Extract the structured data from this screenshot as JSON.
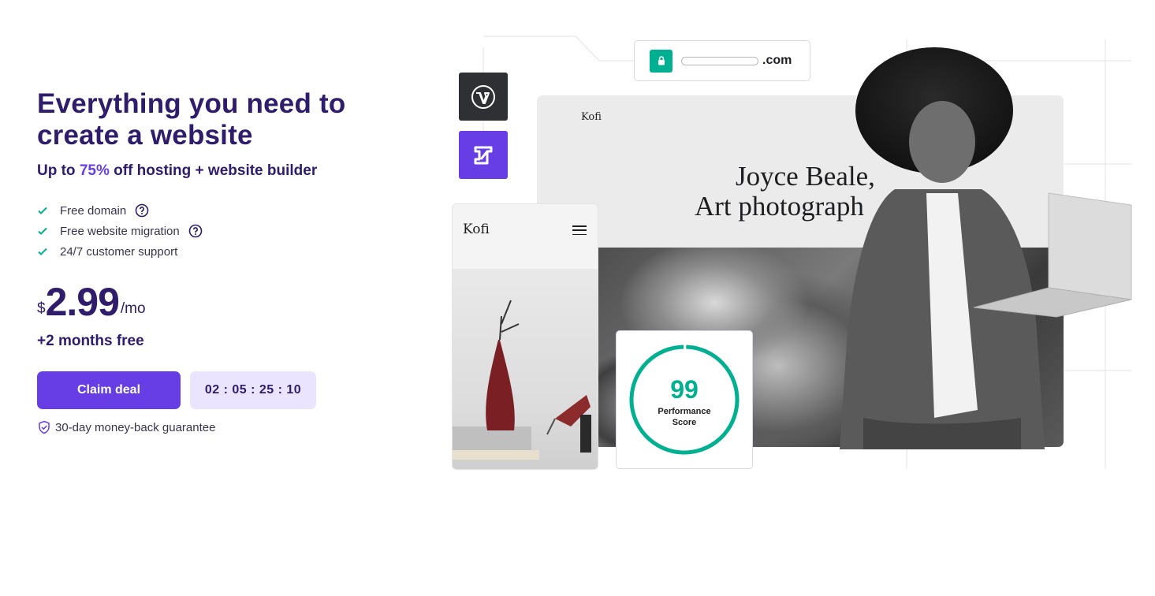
{
  "hero": {
    "headline_line1": "Everything you need to",
    "headline_line2": "create a website",
    "subhead_prefix": "Up to ",
    "subhead_accent": "75%",
    "subhead_suffix": " off hosting + website builder",
    "features": [
      {
        "label": "Free domain",
        "has_help": true
      },
      {
        "label": "Free website migration",
        "has_help": true
      },
      {
        "label": "24/7 customer support",
        "has_help": false
      }
    ],
    "price": {
      "currency": "$",
      "amount": "2.99",
      "period": "/mo"
    },
    "bonus": "+2 months free",
    "claim_label": "Claim deal",
    "timer": "02 : 05 : 25 : 10",
    "guarantee": "30-day money-back guarantee"
  },
  "illustration": {
    "url_tld": ".com",
    "desktop_brand": "Kofi",
    "desktop_title_line1": "Joyce Beale,",
    "desktop_title_line2": "Art photograph",
    "mobile_brand": "Kofi",
    "performance_score": "99",
    "performance_label_line1": "Performance",
    "performance_label_line2": "Score",
    "icons": [
      "wordpress-icon",
      "hostinger-builder-icon",
      "lock-icon",
      "menu-icon"
    ]
  },
  "colors": {
    "brand": "#673de6",
    "heading": "#2f1c6a",
    "success": "#00b090",
    "timer_bg": "#ebe4ff"
  }
}
